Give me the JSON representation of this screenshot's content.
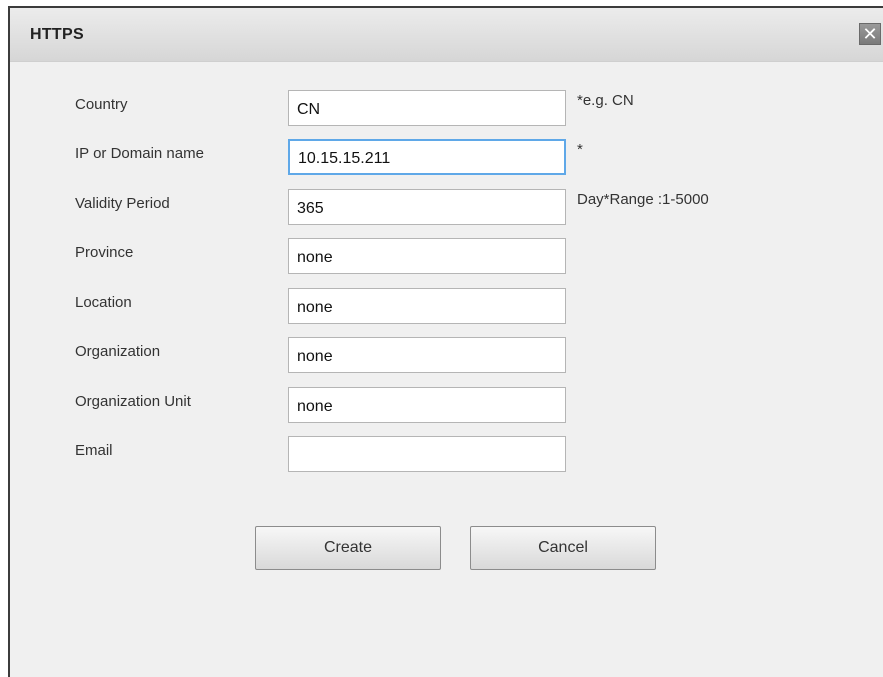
{
  "dialog": {
    "title": "HTTPS",
    "close_glyph": "✕"
  },
  "form": {
    "fields": [
      {
        "label": "Country",
        "value": "CN",
        "hint": "*e.g. CN"
      },
      {
        "label": "IP or Domain name",
        "value": "10.15.15.211",
        "hint": "*"
      },
      {
        "label": "Validity Period",
        "value": "365",
        "hint": "Day*Range :1-5000"
      },
      {
        "label": "Province",
        "value": "none",
        "hint": ""
      },
      {
        "label": "Location",
        "value": "none",
        "hint": ""
      },
      {
        "label": "Organization",
        "value": "none",
        "hint": ""
      },
      {
        "label": "Organization Unit",
        "value": "none",
        "hint": ""
      },
      {
        "label": "Email",
        "value": "",
        "hint": ""
      }
    ]
  },
  "buttons": {
    "create_label": "Create",
    "cancel_label": "Cancel"
  }
}
